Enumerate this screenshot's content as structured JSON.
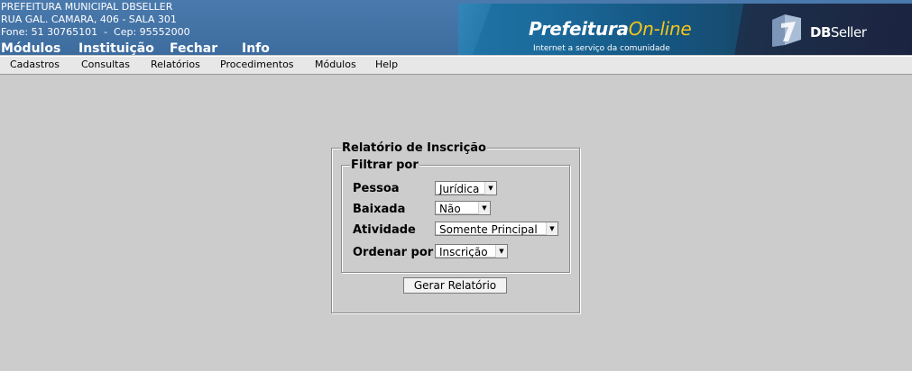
{
  "header": {
    "address_lines": [
      "PREFEITURA MUNICIPAL DBSELLER",
      "RUA GAL. CAMARA, 406 - SALA 301",
      "Fone: 51 30765101  -  Cep: 95552000"
    ],
    "top_menu": [
      "Módulos",
      "Instituição",
      "Fechar",
      "Info"
    ],
    "banner_left": {
      "brand_main": "Prefeitura",
      "brand_accent": "On-line",
      "slogan": "Internet a serviço da comunidade"
    },
    "banner_right": {
      "brand_bold": "DB",
      "brand_rest": "Seller"
    }
  },
  "menubar": [
    "Cadastros",
    "Consultas",
    "Relatórios",
    "Procedimentos",
    "Módulos",
    "Help"
  ],
  "form": {
    "title": "Relatório de Inscrição",
    "fieldset_title": "Filtrar por",
    "fields": [
      {
        "label": "Pessoa",
        "value": "Jurídica"
      },
      {
        "label": "Baixada",
        "value": "Não"
      },
      {
        "label": "Atividade",
        "value": "Somente Principal"
      },
      {
        "label": "Ordenar por",
        "value": "Inscrição"
      }
    ],
    "submit_label": "Gerar Relatório"
  },
  "colors": {
    "header_bg": "#3d6c9f",
    "page_bg": "#cccccc",
    "menubar_bg": "#e7e7e7",
    "brand_accent": "#f5c518"
  },
  "icons": {
    "dropdown": "triangle-down-icon",
    "dbseller_logo": "dbseller-logo-icon"
  }
}
